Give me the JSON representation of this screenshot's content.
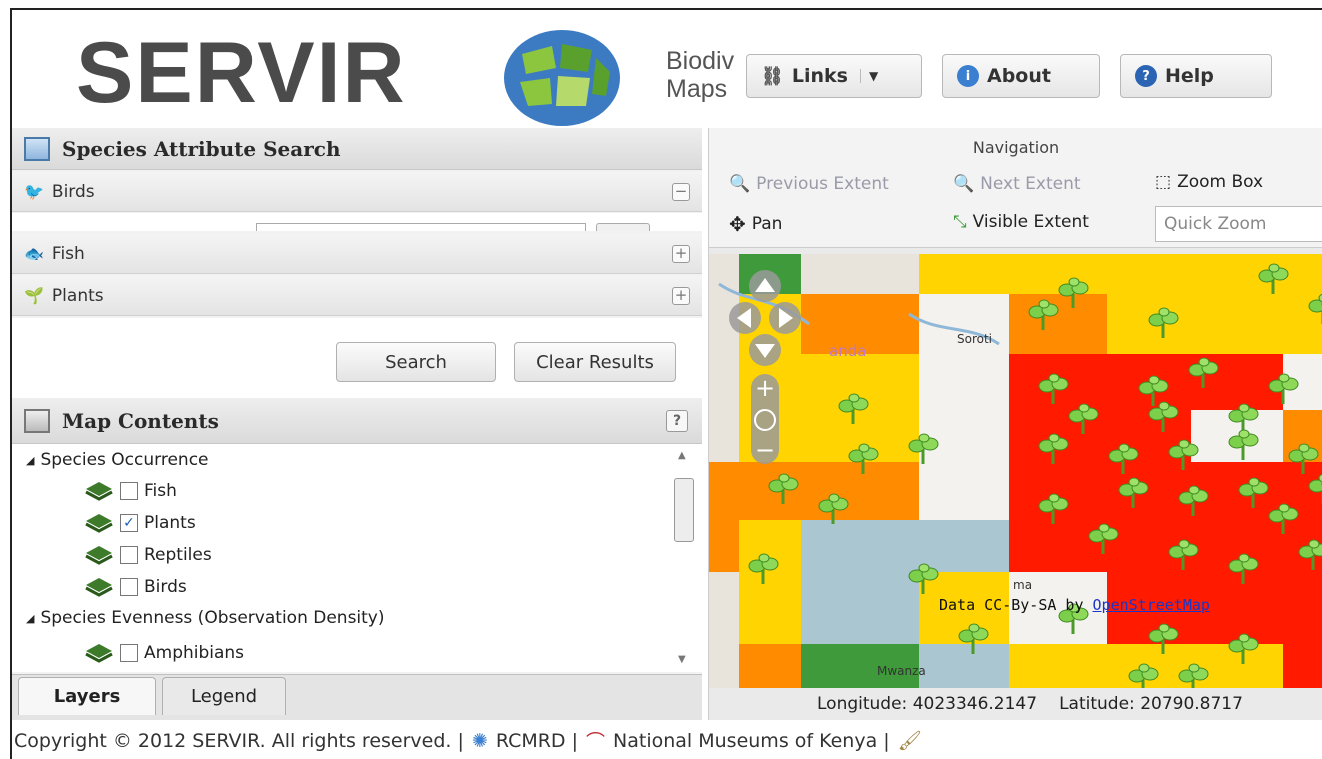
{
  "header": {
    "logo_text": "SERVIR",
    "app_title_line1": "Biodiv",
    "app_title_line2": "Maps",
    "buttons": {
      "links": "Links",
      "about": "About",
      "help": "Help"
    }
  },
  "search_panel": {
    "title": "Species Attribute Search",
    "groups": [
      {
        "label": "Birds",
        "toggle": "−"
      },
      {
        "label": "Fish",
        "toggle": "+"
      },
      {
        "label": "Plants",
        "toggle": "+"
      }
    ],
    "search_label": "Search",
    "clear_label": "Clear Results"
  },
  "map_contents": {
    "title": "Map Contents",
    "help": "?",
    "groups": [
      {
        "label": "Species Occurrence"
      },
      {
        "label": "Species Evenness (Observation Density)"
      }
    ],
    "layers": [
      {
        "label": "Fish",
        "checked": false
      },
      {
        "label": "Plants",
        "checked": true
      },
      {
        "label": "Reptiles",
        "checked": false
      },
      {
        "label": "Birds",
        "checked": false
      },
      {
        "label": "Amphibians",
        "checked": false
      }
    ],
    "tabs": {
      "layers": "Layers",
      "legend": "Legend"
    }
  },
  "navigation": {
    "title": "Navigation",
    "tools": {
      "previous": "Previous Extent",
      "next": "Next Extent",
      "zoom_box": "Zoom Box",
      "pan": "Pan",
      "visible": "Visible Extent"
    },
    "quick_zoom_placeholder": "Quick Zoom"
  },
  "map": {
    "labels": {
      "soroti": "Soroti",
      "uganda": "anda",
      "mwanza": "Mwanza",
      "ma": "ma"
    },
    "attribution_prefix": "Data CC-By-SA by",
    "attribution_link": "OpenStreetMap",
    "longitude_label": "Longitude:",
    "longitude": "4023346.2147",
    "latitude_label": "Latitude:",
    "latitude": "20790.8717"
  },
  "footer": {
    "copyright": "Copyright © 2012 SERVIR. All rights reserved. |",
    "rcmrd": "RCMRD |",
    "museums": "National Museums of Kenya |"
  },
  "colors": {
    "red": "#ff1a00",
    "orange": "#ff8c00",
    "yellow": "#ffd400",
    "water": "#aac6d0",
    "brand_blue": "#2c64b4"
  }
}
